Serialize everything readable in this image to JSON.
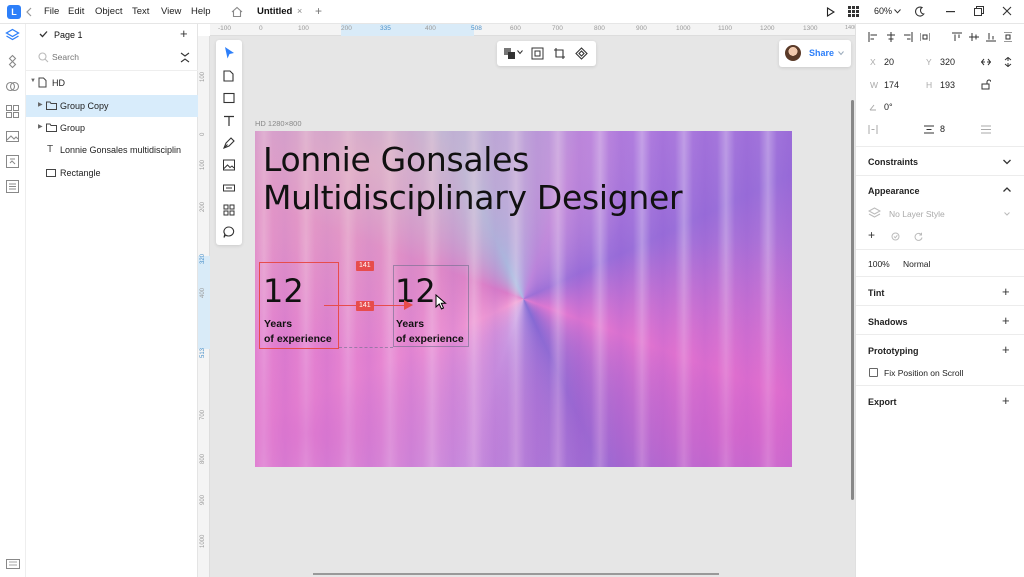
{
  "menu": [
    "File",
    "Edit",
    "Object",
    "Text",
    "View",
    "Help"
  ],
  "tab": {
    "title": "Untitled",
    "close": "×",
    "add": "+"
  },
  "top_right": {
    "zoom": "60%"
  },
  "layers": {
    "page_name": "Page 1",
    "search_placeholder": "Search",
    "items": [
      {
        "label": "HD"
      },
      {
        "label": "Group Copy"
      },
      {
        "label": "Group"
      },
      {
        "label": "Lonnie Gonsales multidisciplin"
      },
      {
        "label": "Rectangle"
      }
    ]
  },
  "ruler_top": [
    "-100",
    "0",
    "100",
    "200",
    "335",
    "400",
    "508",
    "600",
    "700",
    "800",
    "900",
    "1000",
    "1100",
    "1200",
    "1300",
    "1400"
  ],
  "ruler_left": [
    "100",
    "0",
    "100",
    "200",
    "320",
    "400",
    "513",
    "700",
    "800",
    "900",
    "1000"
  ],
  "share": {
    "label": "Share"
  },
  "artboard": {
    "frame_label": "HD 1280×800",
    "headline_line1": "Lonnie Gonsales",
    "headline_line2": "Multidisciplinary Designer",
    "stat1": {
      "number": "12",
      "label1": "Years",
      "label2": "of experience"
    },
    "stat2": {
      "number": "12",
      "label1": "Years",
      "label2": "of experience"
    },
    "measure_top": "141",
    "measure_mid": "141"
  },
  "inspector": {
    "x_label": "X",
    "x": "20",
    "y_label": "Y",
    "y": "320",
    "w_label": "W",
    "w": "174",
    "h_label": "H",
    "h": "193",
    "rotation": "0°",
    "spacing": "8",
    "sections": {
      "constraints": "Constraints",
      "appearance": "Appearance",
      "layer_style": "No Layer Style",
      "opacity": "100%",
      "blend": "Normal",
      "tint": "Tint",
      "shadows": "Shadows",
      "prototyping": "Prototyping",
      "fix_position": "Fix Position on Scroll",
      "export": "Export"
    }
  },
  "colors": {
    "accent": "#2d7ff9",
    "measure": "#e74c4c",
    "selection_row": "#d8ecfb"
  }
}
